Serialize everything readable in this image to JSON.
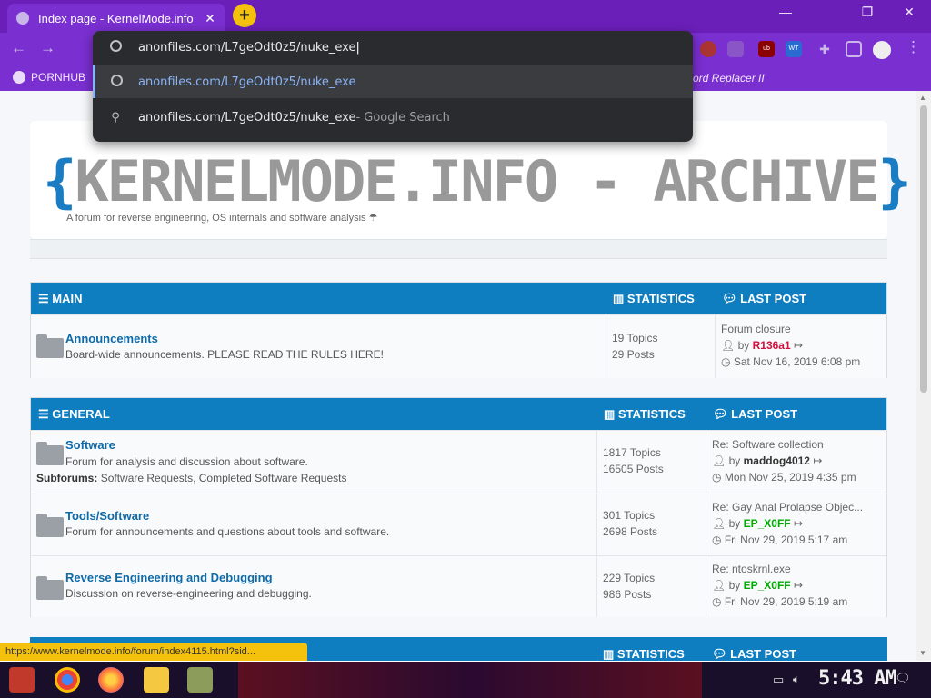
{
  "browser": {
    "tab_title": "Index page - KernelMode.info",
    "new_tab_label": "+",
    "minimize": "—",
    "restore": "❐",
    "close": "✕",
    "back": "←",
    "forward": "→",
    "extensions": [
      "ub",
      "WT"
    ]
  },
  "bookmarks": {
    "first": "PORNHUB",
    "second": "ord Replacer II"
  },
  "omnibox": {
    "input_value": "anonfiles.com/L7geOdt0z5/nuke_exe",
    "suggestion_url": "anonfiles.com/L7geOdt0z5/nuke_exe",
    "suggestion_search": "anonfiles.com/L7geOdt0z5/nuke_exe",
    "suggestion_search_suffix": " - Google Search"
  },
  "site": {
    "logo_open": "{",
    "logo_text": "KERNELMODE.INFO - ARCHIVE",
    "logo_close": "}",
    "tagline": "A forum for reverse engineering, OS internals and software analysis ☂"
  },
  "main": {
    "title": "MAIN",
    "stat_head": "STATISTICS",
    "lp_head": "LAST POST",
    "forums": [
      {
        "name": "Announcements",
        "desc": "Board-wide announcements. PLEASE READ THE RULES HERE!",
        "topics": "19 Topics",
        "posts": "29 Posts",
        "lp_title": "Forum closure",
        "lp_by": "by",
        "lp_user": "R136a1",
        "lp_date": "Sat Nov 16, 2019 6:08 pm"
      }
    ]
  },
  "general": {
    "title": "GENERAL",
    "stat_head": "STATISTICS",
    "lp_head": "LAST POST",
    "forums": [
      {
        "name": "Software",
        "desc": "Forum for analysis and discussion about software.",
        "sub_label": "Subforums:",
        "sub_value": "Software Requests, Completed Software Requests",
        "topics": "1817 Topics",
        "posts": "16505 Posts",
        "lp_title": "Re: Software collection",
        "lp_by": "by",
        "lp_user": "maddog4012",
        "lp_date": "Mon Nov 25, 2019 4:35 pm"
      },
      {
        "name": "Tools/Software",
        "desc": "Forum for announcements and questions about tools and software.",
        "topics": "301 Topics",
        "posts": "2698 Posts",
        "lp_title": "Re: Gay Anal Prolapse Objec...",
        "lp_by": "by",
        "lp_user": "EP_X0FF",
        "lp_date": "Fri Nov 29, 2019 5:17 am"
      },
      {
        "name": "Reverse Engineering and Debugging",
        "desc": "Discussion on reverse-engineering and debugging.",
        "topics": "229 Topics",
        "posts": "986 Posts",
        "lp_title": "Re: ntoskrnl.exe",
        "lp_by": "by",
        "lp_user": "EP_X0FF",
        "lp_date": "Fri Nov 29, 2019 5:19 am"
      }
    ]
  },
  "third": {
    "stat_head": "STATISTICS",
    "lp_head": "LAST POST"
  },
  "status_url": "https://www.kernelmode.info/forum/index4115.html?sid...",
  "taskbar": {
    "clock": "5:43 AM"
  },
  "colors": {
    "chrome": "#7a2fd0",
    "forum_blue": "#0e7ec0",
    "link": "#0e6aa8",
    "admin_red": "#d31141",
    "mod_green": "#00aa00"
  }
}
